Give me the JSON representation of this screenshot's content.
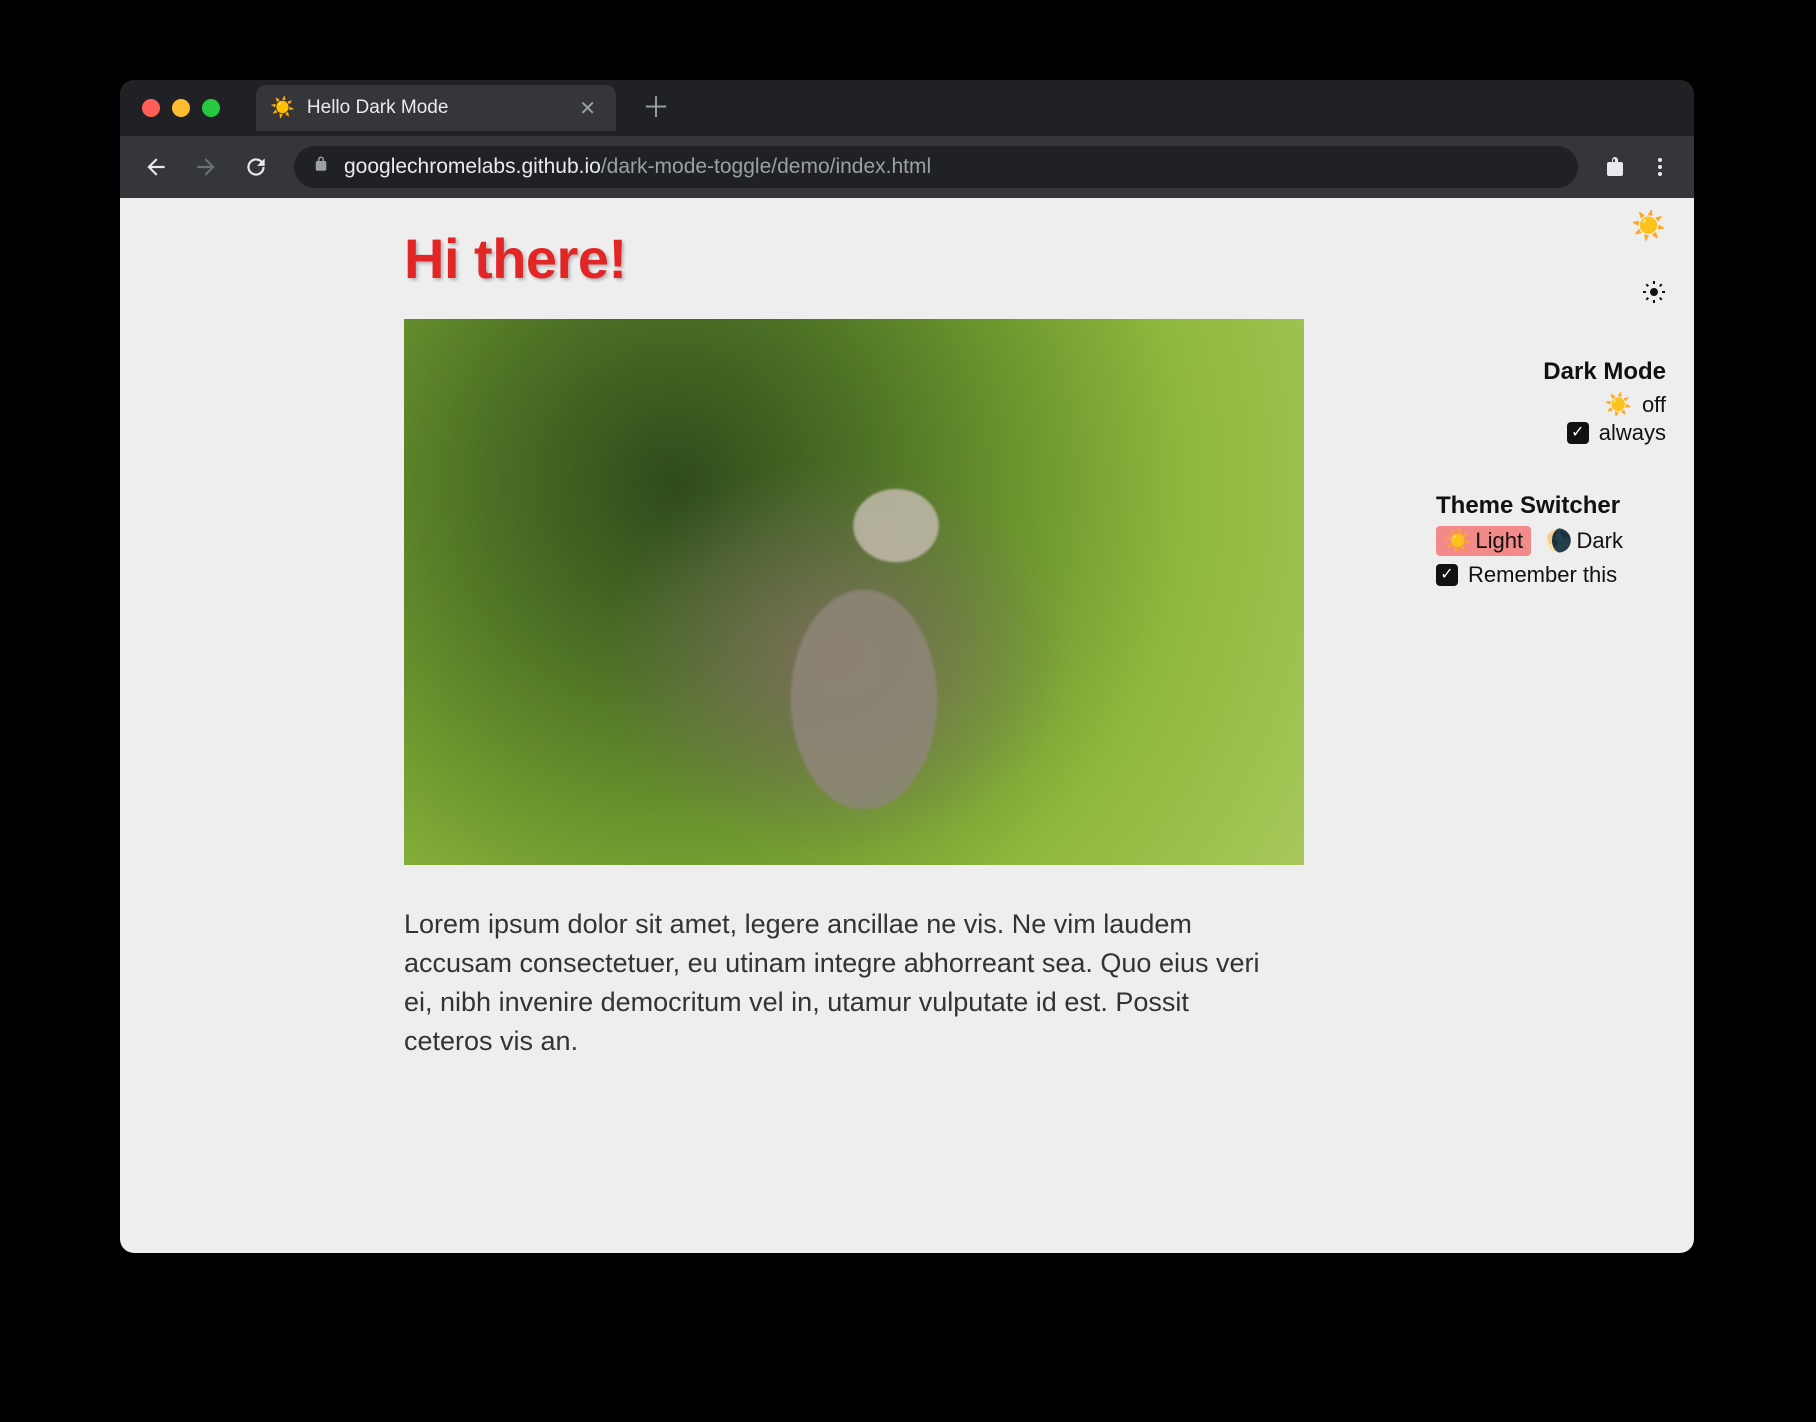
{
  "browser": {
    "tab": {
      "favicon": "☀️",
      "title": "Hello Dark Mode"
    },
    "url": {
      "host": "googlechromelabs.github.io",
      "path": "/dark-mode-toggle/demo/index.html"
    }
  },
  "page": {
    "heading": "Hi there!",
    "paragraph": "Lorem ipsum dolor sit amet, legere ancillae ne vis. Ne vim laudem accusam consectetuer, eu utinam integre abhorreant sea. Quo eius veri ei, nibh invenire democritum vel in, utamur vulputate id est. Possit ceteros vis an."
  },
  "side": {
    "mini_sun": "☀️",
    "dark_mode": {
      "title": "Dark Mode",
      "state_icon": "☀️",
      "state_label": "off",
      "always_label": "always",
      "always_checked": true
    },
    "theme_switcher": {
      "title": "Theme Switcher",
      "light_icon": "☀️",
      "light_label": "Light",
      "dark_icon": "🌘",
      "dark_label": "Dark",
      "selected": "light",
      "remember_label": "Remember this",
      "remember_checked": true
    }
  }
}
